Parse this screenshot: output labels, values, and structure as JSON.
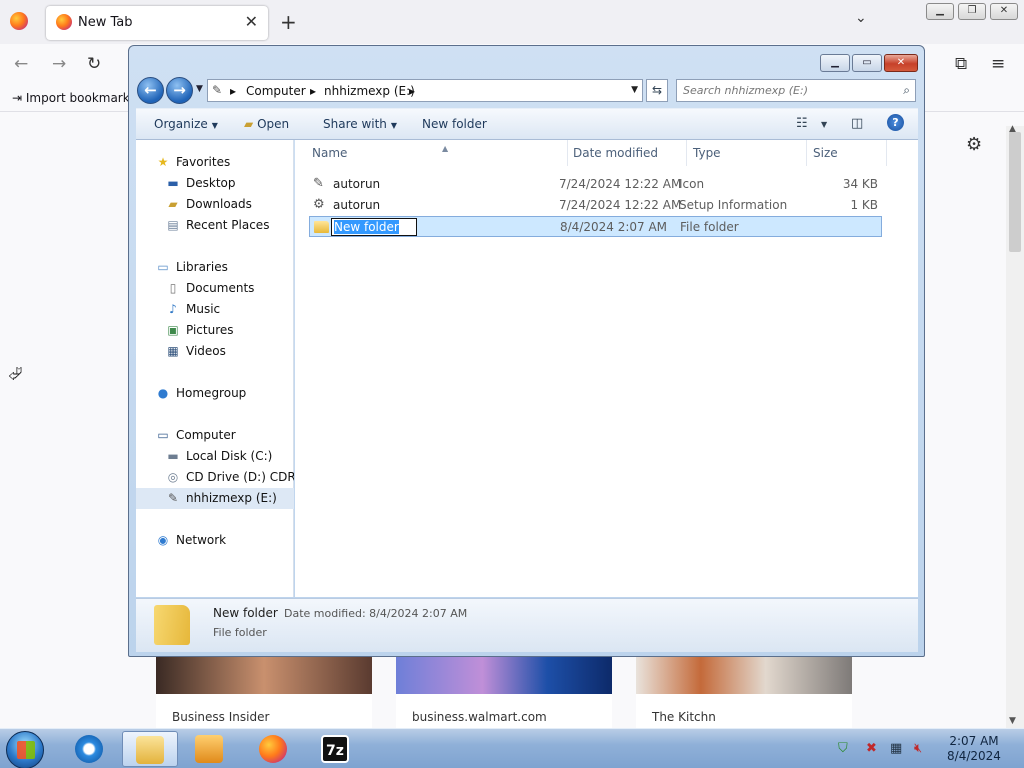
{
  "browser": {
    "tab_title": "New Tab",
    "tab_close": "✕",
    "new_tab": "+",
    "import_bookmarks": "Import bookmarks",
    "tiles": [
      {
        "label": "Business Insider"
      },
      {
        "label": "business.walmart.com"
      },
      {
        "label": "The Kitchn"
      }
    ]
  },
  "explorer": {
    "address": {
      "segments": [
        "Computer",
        "nhhizmexp (E:)"
      ]
    },
    "search_placeholder": "Search nhhizmexp (E:)",
    "toolbar": {
      "organize": "Organize",
      "open": "Open",
      "share_with": "Share with",
      "new_folder": "New folder"
    },
    "nav": {
      "favorites": "Favorites",
      "desktop": "Desktop",
      "downloads": "Downloads",
      "recent_places": "Recent Places",
      "libraries": "Libraries",
      "documents": "Documents",
      "music": "Music",
      "pictures": "Pictures",
      "videos": "Videos",
      "homegroup": "Homegroup",
      "computer": "Computer",
      "local_disk": "Local Disk (C:)",
      "cd_drive": "CD Drive (D:) CDROM",
      "usb_drive": "nhhizmexp (E:)",
      "network": "Network"
    },
    "columns": {
      "name": "Name",
      "date": "Date modified",
      "type": "Type",
      "size": "Size"
    },
    "files": [
      {
        "name": "autorun",
        "date": "7/24/2024 12:22 AM",
        "type": "Icon",
        "size": "34 KB"
      },
      {
        "name": "autorun",
        "date": "7/24/2024 12:22 AM",
        "type": "Setup Information",
        "size": "1 KB"
      },
      {
        "name": "New folder",
        "date": "8/4/2024 2:07 AM",
        "type": "File folder",
        "size": ""
      }
    ],
    "details": {
      "name": "New folder",
      "date_label": "Date modified: 8/4/2024 2:07 AM",
      "type": "File folder"
    }
  },
  "taskbar": {
    "time": "2:07 AM",
    "date": "8/4/2024",
    "seven_zip": "7z"
  }
}
